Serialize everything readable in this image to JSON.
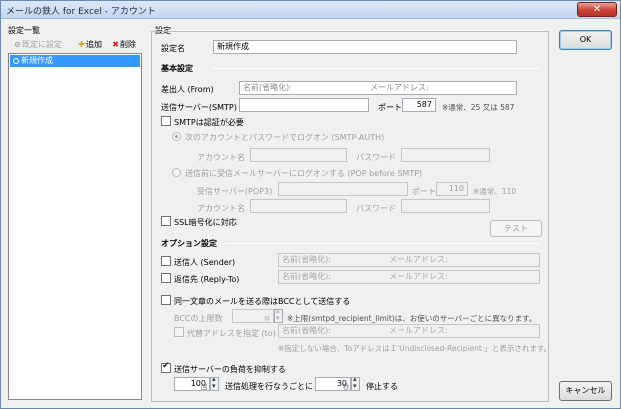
{
  "window": {
    "title": "メールの鉄人 for Excel - アカウント",
    "close": "✕"
  },
  "left": {
    "group": "設定一覧",
    "toolbar": {
      "default": "既定に設定",
      "add": "追加",
      "delete": "削除"
    },
    "items": [
      "新規作成"
    ]
  },
  "main": {
    "group": "設定",
    "name_label": "設定名",
    "name_value": "新規作成",
    "basic": {
      "title": "基本設定",
      "from_label": "差出人 (From)",
      "name_ph": "名前(省略化):",
      "mail_ph": "メールアドレス:",
      "smtp_label": "送信サーバー(SMTP)",
      "port_label": "ポート",
      "port_value": "587",
      "port_note": "※通常、25 又は 587",
      "auth_label": "SMTPは認証が必要",
      "auth_opt1": "次のアカウントとパスワードでログオン (SMTP-AUTH)",
      "account_label": "アカウント名",
      "password_label": "パスワード",
      "auth_opt2": "送信前に受信メールサーバーにログオンする (POP before SMTP)",
      "pop_label": "受信サーバー(POP3)",
      "pop_port_label": "ポート",
      "pop_port_value": "110",
      "pop_port_note": "※通常、110",
      "ssl_label": "SSL暗号化に対応",
      "test_button": "テスト"
    },
    "options": {
      "title": "オプション設定",
      "sender_label": "送信人 (Sender)",
      "replyto_label": "返信先 (Reply-To)",
      "bcc_label": "同一文章のメールを送る際はBCCとして送信する",
      "bcc_limit_label": "BCCの上限数",
      "bcc_unit": "件",
      "bcc_note": "※上限(smtpd_recipient_limit)は、お使いのサーバーごとに異なります。",
      "alt_to_label": "代替アドレスを指定 (to)",
      "alt_note": "※指定しない場合、ToアドレスはＩ'Undisclosed-Recipient:」と表示されます。",
      "throttle_label": "送信サーバーの負荷を抑制する",
      "throttle_count": "100",
      "throttle_count_unit": "回",
      "throttle_text": "送信処理を行なうごとに",
      "throttle_secs": "30",
      "throttle_secs_unit": "秒",
      "throttle_stop": "停止する"
    }
  },
  "buttons": {
    "ok": "OK",
    "cancel": "キャンセル"
  }
}
